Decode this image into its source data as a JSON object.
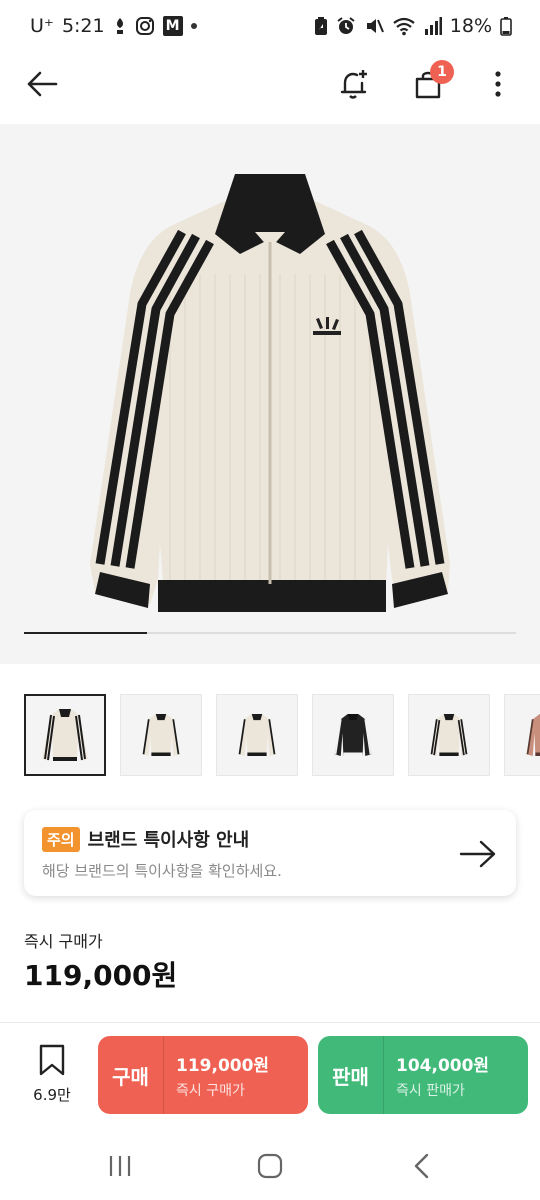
{
  "status_bar": {
    "carrier": "U⁺",
    "time": "5:21",
    "battery": "18%",
    "icons": [
      "carrier-signal-icon",
      "instagram-icon",
      "m-app-icon",
      "notification-dot",
      "battery-saver-icon",
      "alarm-icon",
      "mute-icon",
      "wifi-icon",
      "signal-icon",
      "battery-icon"
    ]
  },
  "app_bar": {
    "cart_count": "1",
    "icons": [
      "back-arrow-icon",
      "add-alarm-icon",
      "shopping-bag-icon",
      "more-vertical-icon"
    ]
  },
  "gallery": {
    "image": "adidas-track-jacket-cream",
    "progress_fraction": 0.25,
    "thumbnails": [
      {
        "variant": "cream-black",
        "selected": true
      },
      {
        "variant": "cream-black-front",
        "selected": false
      },
      {
        "variant": "cream-black-angle",
        "selected": false
      },
      {
        "variant": "black-white",
        "selected": false
      },
      {
        "variant": "cream-black-detail",
        "selected": false
      },
      {
        "variant": "pink-brown",
        "selected": false
      }
    ]
  },
  "notice": {
    "badge": "주의",
    "title": "브랜드 특이사항 안내",
    "description": "해당 브랜드의 특이사항을 확인하세요."
  },
  "price": {
    "label": "즉시 구매가",
    "value": "119,000원"
  },
  "action_bar": {
    "wish_count": "6.9만",
    "buy": {
      "kind": "구매",
      "price": "119,000원",
      "sub": "즉시 구매가"
    },
    "sell": {
      "kind": "판매",
      "price": "104,000원",
      "sub": "즉시 판매가"
    }
  },
  "colors": {
    "buy": "#ef6253",
    "sell": "#41b979",
    "notice_badge": "#f3932e",
    "badge": "#ef6253"
  }
}
